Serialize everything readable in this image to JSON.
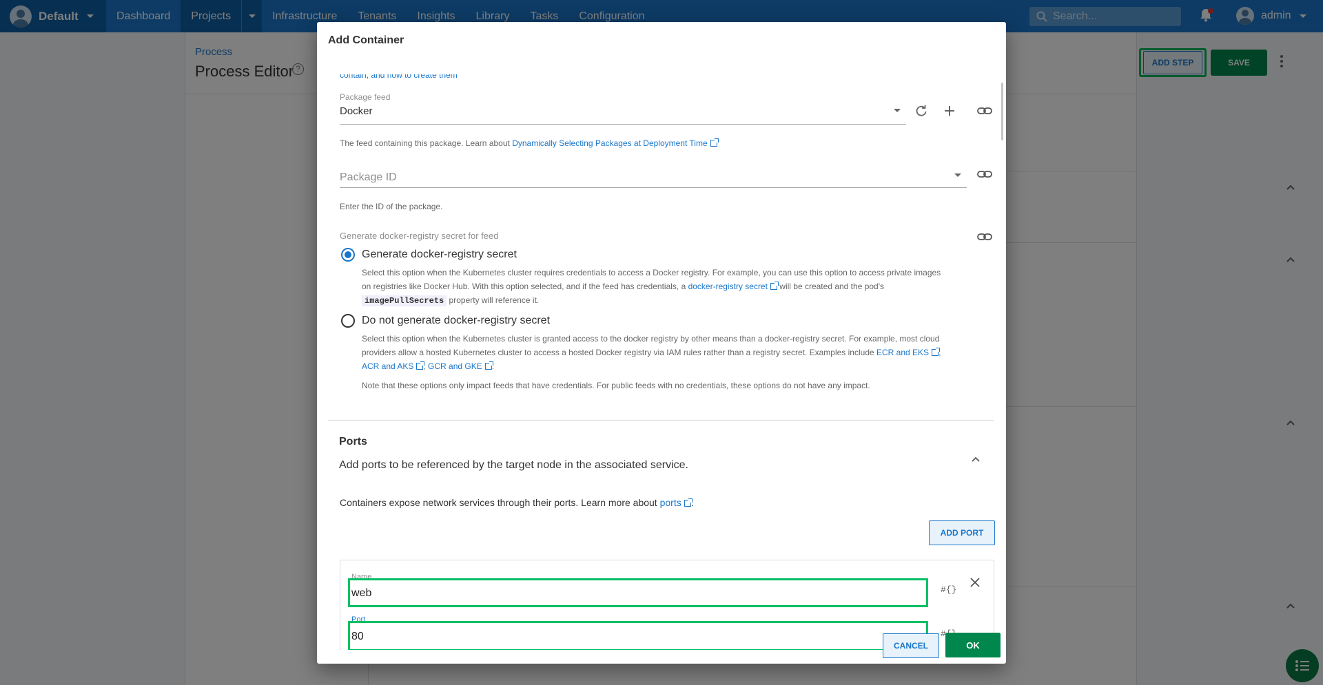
{
  "nav": {
    "space": "Default",
    "items": [
      "Dashboard",
      "Projects",
      "Infrastructure",
      "Tenants",
      "Insights",
      "Library",
      "Tasks",
      "Configuration"
    ],
    "search_placeholder": "Search...",
    "user": "admin"
  },
  "page": {
    "breadcrumb": "Process",
    "title": "Process Editor",
    "add_step": "ADD STEP",
    "save": "SAVE"
  },
  "dialog": {
    "title": "Add Container",
    "cut_link": "contain, and how to create them",
    "package_feed": {
      "label": "Package feed",
      "value": "Docker",
      "help_prefix": "The feed containing this package. Learn about ",
      "help_link": "Dynamically Selecting Packages at Deployment Time"
    },
    "package_id": {
      "placeholder": "Package ID",
      "help": "Enter the ID of the package."
    },
    "registry": {
      "label": "Generate docker-registry secret for feed",
      "option1_label": "Generate docker-registry secret",
      "option1_desc_a": "Select this option when the Kubernetes cluster requires credentials to access a Docker registry. For example, you can use this option to access private images",
      "option1_desc_b": "on registries like Docker Hub. With this option selected, and if the feed has credentials, a ",
      "option1_link": "docker-registry secret",
      "option1_desc_c": " will be created and the pod's",
      "option1_code": "imagePullSecrets",
      "option1_desc_d": " property will reference it.",
      "option2_label": "Do not generate docker-registry secret",
      "option2_desc_a": "Select this option when the Kubernetes cluster is granted access to the docker registry by other means than a docker-registry secret. For example, most cloud",
      "option2_desc_b": "providers allow a hosted Kubernetes cluster to access a hosted Docker registry via IAM rules rather than a registry secret. Examples include ",
      "option2_link1": "ECR and EKS",
      "option2_link2": "ACR and AKS",
      "option2_link3": "GCR and GKE",
      "note": "Note that these options only impact feeds that have credentials. For public feeds with no credentials, these options do not have any impact."
    },
    "ports": {
      "title": "Ports",
      "description": "Add ports to be referenced by the target node in the associated service.",
      "text_prefix": "Containers expose network services through their ports. Learn more about ",
      "text_link": "ports",
      "add_port": "ADD PORT",
      "name_label": "Name",
      "name_value": "web",
      "port_label": "Port",
      "port_value": "80",
      "binding_hint": "#{}"
    },
    "cancel": "CANCEL",
    "ok": "OK"
  }
}
